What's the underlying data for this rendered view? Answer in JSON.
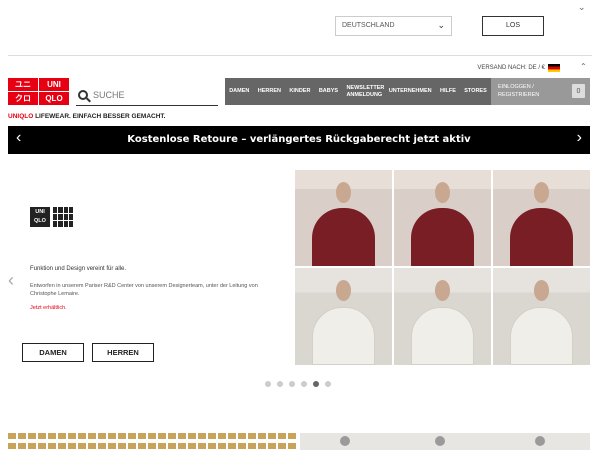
{
  "topbar": {
    "country": "DEUTSCHLAND",
    "go_label": "LOS",
    "shipping": "VERSAND NACH: DE / €"
  },
  "logo": {
    "cells": [
      "ユニ",
      "UNI",
      "クロ",
      "QLO"
    ]
  },
  "search": {
    "label": "SUCHE"
  },
  "nav": {
    "items": [
      {
        "label": "DAMEN"
      },
      {
        "label": "HERREN"
      },
      {
        "label": "KINDER"
      },
      {
        "label": "BABYS"
      },
      {
        "label": "NEWSLETTER ANMELDUNG"
      },
      {
        "label": "UNTERNEHMEN"
      },
      {
        "label": "HILFE"
      },
      {
        "label": "STORES"
      }
    ],
    "login": "EINLOGGEN / REGISTRIEREN",
    "cart_count": "0"
  },
  "tagline": {
    "brand": "UNIQLO",
    "text": " LIFEWEAR. EINFACH BESSER GEMACHT."
  },
  "banner": {
    "text": "Kostenlose Retoure – verlängertes Rückgaberecht jetzt aktiv"
  },
  "hero": {
    "logo_box": "UNI QLO",
    "headline": "Funktion und Design vereint für alle.",
    "description": "Entworfen in unserem Pariser R&D Center von unserem Designerteam, unter der Leitung von Christophe Lemaire.",
    "link": "Jetzt erhältlich.",
    "buttons": [
      "DAMEN",
      "HERREN"
    ],
    "dots_total": 6,
    "dots_active": 5
  },
  "colors": {
    "brand_red": "#e60012",
    "nav_bg": "#666666",
    "banner_bg": "#000000",
    "jacket_red": "#7a1e26"
  }
}
